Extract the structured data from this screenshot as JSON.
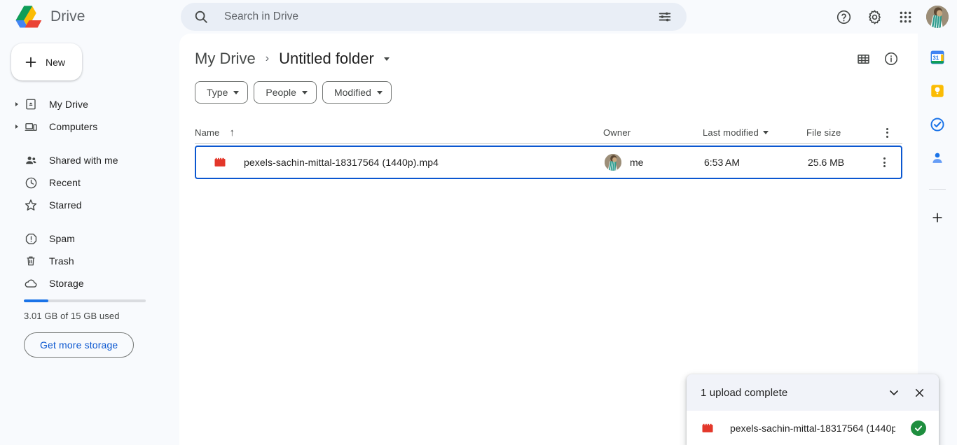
{
  "app": {
    "brand_name": "Drive",
    "logo_icon": "drive-logo-icon"
  },
  "search": {
    "placeholder": "Search in Drive",
    "value": "",
    "search_icon": "search-icon",
    "tune_icon": "tune-icon"
  },
  "topbar_actions": [
    {
      "name": "help-icon",
      "label": "Help"
    },
    {
      "name": "settings-icon",
      "label": "Settings"
    },
    {
      "name": "apps-grid-icon",
      "label": "Google apps"
    },
    {
      "name": "avatar",
      "label": "Account"
    }
  ],
  "sidebar": {
    "new_button": "New",
    "new_icon": "plus-icon",
    "items": [
      {
        "label": "My Drive",
        "icon": "my-drive-icon",
        "expandable": true
      },
      {
        "label": "Computers",
        "icon": "computers-icon",
        "expandable": true
      },
      {
        "label": "Shared with me",
        "icon": "shared-with-me-icon",
        "expandable": false
      },
      {
        "label": "Recent",
        "icon": "recent-clock-icon",
        "expandable": false
      },
      {
        "label": "Starred",
        "icon": "star-icon",
        "expandable": false
      },
      {
        "label": "Spam",
        "icon": "spam-icon",
        "expandable": false
      },
      {
        "label": "Trash",
        "icon": "trash-icon",
        "expandable": false
      },
      {
        "label": "Storage",
        "icon": "cloud-icon",
        "expandable": false
      }
    ],
    "storage": {
      "text": "3.01 GB of 15 GB used",
      "used_percent": 20,
      "button_label": "Get more storage",
      "bar_color": "#1a73e8"
    }
  },
  "breadcrumb": {
    "root": "My Drive",
    "separator": "›",
    "current": "Untitled folder"
  },
  "header_actions": [
    {
      "name": "grid-view-icon",
      "label": "Grid view"
    },
    {
      "name": "info-icon",
      "label": "View details"
    }
  ],
  "filters": [
    {
      "label": "Type"
    },
    {
      "label": "People"
    },
    {
      "label": "Modified"
    }
  ],
  "table": {
    "columns": {
      "name": "Name",
      "owner": "Owner",
      "modified": "Last modified",
      "size": "File size"
    },
    "sort_indicator": "↑",
    "rows": [
      {
        "name": "pexels-sachin-mittal-18317564 (1440p).mp4",
        "icon": "video-file-icon",
        "owner": "me",
        "modified": "6:53 AM",
        "size": "25.6 MB",
        "selected": true
      }
    ]
  },
  "right_rail": [
    {
      "name": "calendar-icon",
      "label": "Calendar",
      "badge": "31"
    },
    {
      "name": "keep-icon",
      "label": "Keep"
    },
    {
      "name": "tasks-icon",
      "label": "Tasks"
    },
    {
      "name": "contacts-icon",
      "label": "Contacts"
    },
    {
      "name": "add-apps-icon",
      "label": "Get add-ons"
    }
  ],
  "toast": {
    "title": "1 upload complete",
    "collapse_icon": "chevron-down-icon",
    "close_icon": "close-icon",
    "items": [
      {
        "name": "pexels-sachin-mittal-18317564 (1440p...",
        "icon": "video-file-icon",
        "status_icon": "success-check-icon"
      }
    ]
  },
  "colors": {
    "accent": "#0b57d0",
    "panel": "#ffffff",
    "background": "#f8fafd",
    "search_bg": "#e9eef6",
    "success": "#1e8e3e",
    "video_red": "#e3372a"
  }
}
